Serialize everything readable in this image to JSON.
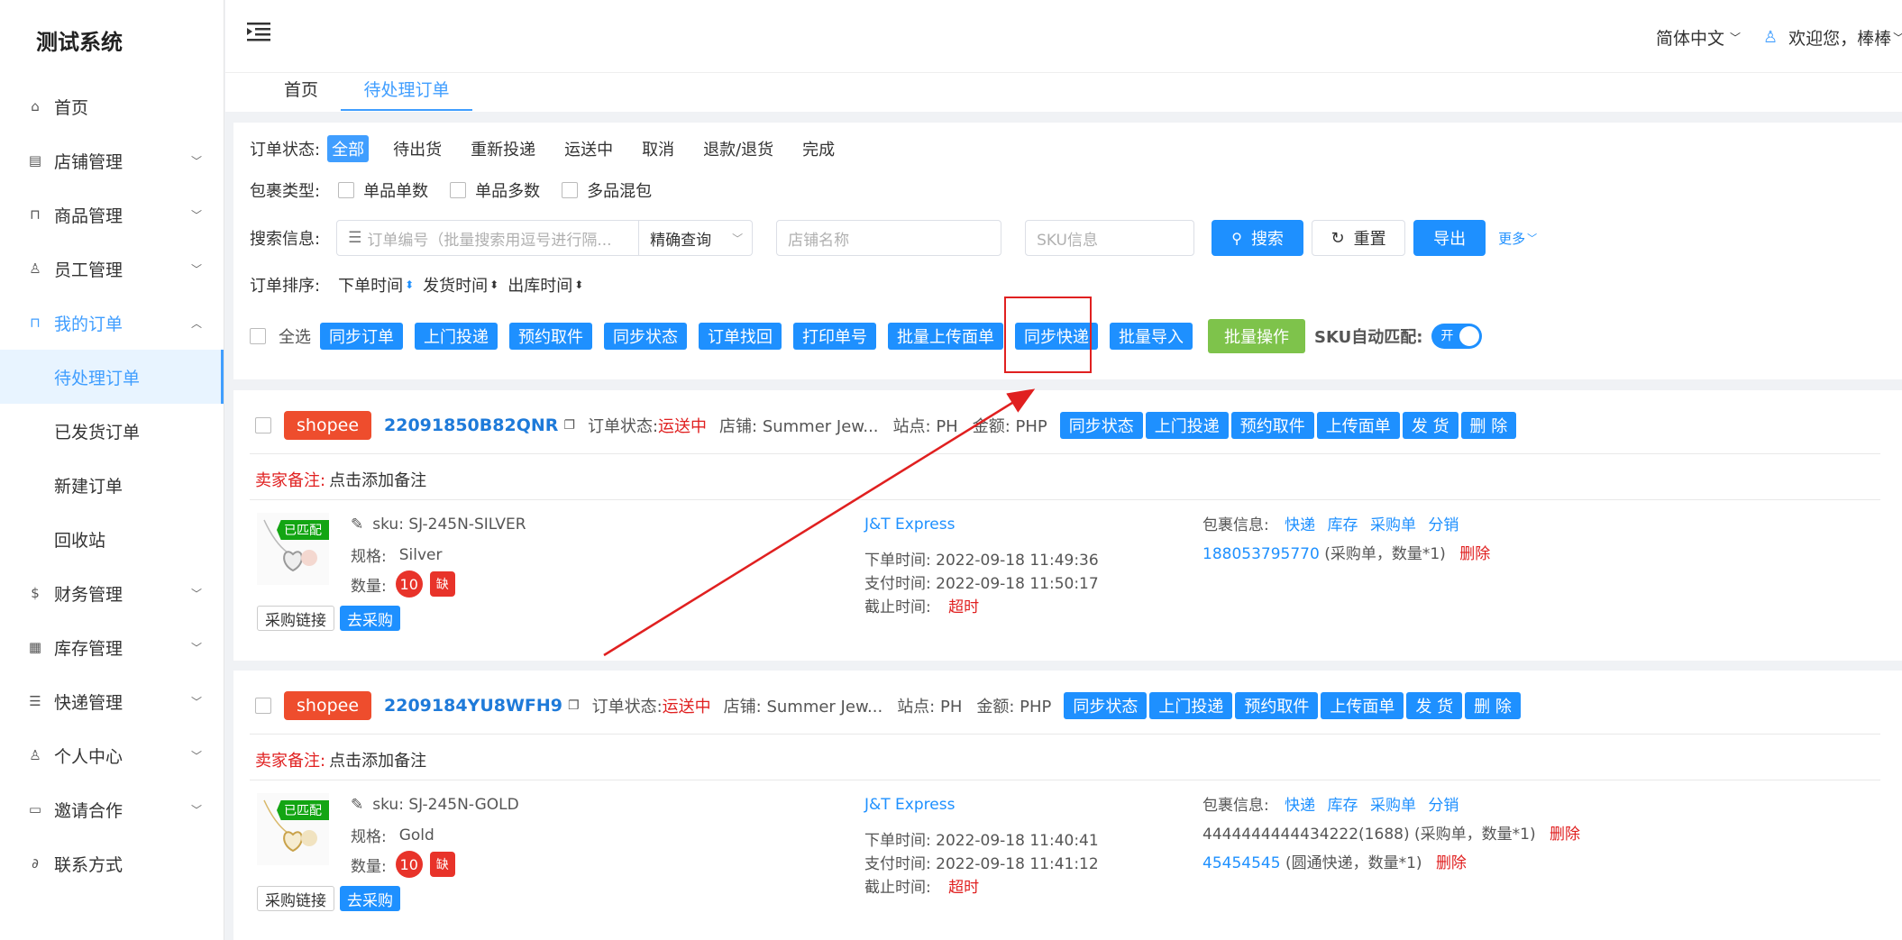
{
  "app": {
    "title": "测试系统"
  },
  "sidebar": {
    "items": [
      {
        "label": "首页"
      },
      {
        "label": "店铺管理"
      },
      {
        "label": "商品管理"
      },
      {
        "label": "员工管理"
      },
      {
        "label": "我的订单"
      },
      {
        "label": "财务管理"
      },
      {
        "label": "库存管理"
      },
      {
        "label": "快递管理"
      },
      {
        "label": "个人中心"
      },
      {
        "label": "邀请合作"
      },
      {
        "label": "联系方式"
      }
    ],
    "order_submenu": [
      {
        "label": "待处理订单"
      },
      {
        "label": "已发货订单"
      },
      {
        "label": "新建订单"
      },
      {
        "label": "回收站"
      }
    ]
  },
  "header": {
    "language": "简体中文",
    "welcome": "欢迎您，棒棒"
  },
  "tabs": [
    {
      "label": "首页"
    },
    {
      "label": "待处理订单"
    }
  ],
  "filters": {
    "status_label": "订单状态:",
    "status_options": [
      "全部",
      "待出货",
      "重新投递",
      "运送中",
      "取消",
      "退款/退货",
      "完成"
    ],
    "package_label": "包裹类型:",
    "package_options": [
      "单品单数",
      "单品多数",
      "多品混包"
    ],
    "search_label": "搜索信息:",
    "order_no_placeholder": "订单编号（批量搜索用逗号进行隔...",
    "match_mode": "精确查询",
    "shop_placeholder": "店铺名称",
    "sku_placeholder": "SKU信息",
    "search_btn": "搜索",
    "reset_btn": "重置",
    "export_btn": "导出",
    "more": "更多",
    "sort_label": "订单排序:",
    "sort_options": [
      "下单时间",
      "发货时间",
      "出库时间"
    ],
    "select_all": "全选",
    "batch_buttons": [
      "同步订单",
      "上门投递",
      "预约取件",
      "同步状态",
      "订单找回",
      "打印单号",
      "批量上传面单",
      "同步快递",
      "批量导入"
    ],
    "batch_ops": "批量操作",
    "sku_auto_match": "SKU自动匹配:",
    "toggle_label": "开"
  },
  "orders": [
    {
      "platform": "shopee",
      "order_no": "22091850B82QNR",
      "status_label": "订单状态:",
      "status": "运送中",
      "shop": "店铺: Summer Jew...",
      "site": "站点: PH",
      "amount": "金额: PHP",
      "actions": [
        "同步状态",
        "上门投递",
        "预约取件",
        "上传面单",
        "发 货",
        "删 除"
      ],
      "remark_label": "卖家备注:",
      "remark": "点击添加备注",
      "matched": "已匹配",
      "sku": "sku: SJ-245N-SILVER",
      "spec_label": "规格:",
      "spec": "Silver",
      "qty_label": "数量:",
      "qty": "10",
      "short": "缺",
      "purchase_link": "采购链接",
      "go_purchase": "去采购",
      "carrier": "J&T Express",
      "order_time": "下单时间:  2022-09-18 11:49:36",
      "pay_time": "支付时间:  2022-09-18 11:50:17",
      "deadline_label": "截止时间:",
      "deadline": "超时",
      "pkg_label": "包裹信息:",
      "pkg_links": [
        "快递",
        "库存",
        "采购单",
        "分销"
      ],
      "pkg_lines": [
        {
          "id": "188053795770",
          "note": "(采购单，数量*1)",
          "del": "删除",
          "link": true
        }
      ]
    },
    {
      "platform": "shopee",
      "order_no": "2209184YU8WFH9",
      "status_label": "订单状态:",
      "status": "运送中",
      "shop": "店铺: Summer Jew...",
      "site": "站点: PH",
      "amount": "金额: PHP",
      "actions": [
        "同步状态",
        "上门投递",
        "预约取件",
        "上传面单",
        "发 货",
        "删 除"
      ],
      "remark_label": "卖家备注:",
      "remark": "点击添加备注",
      "matched": "已匹配",
      "sku": "sku: SJ-245N-GOLD",
      "spec_label": "规格:",
      "spec": "Gold",
      "qty_label": "数量:",
      "qty": "10",
      "short": "缺",
      "purchase_link": "采购链接",
      "go_purchase": "去采购",
      "carrier": "J&T Express",
      "order_time": "下单时间:  2022-09-18 11:40:41",
      "pay_time": "支付时间:  2022-09-18 11:41:12",
      "deadline_label": "截止时间:",
      "deadline": "超时",
      "pkg_label": "包裹信息:",
      "pkg_links": [
        "快递",
        "库存",
        "采购单",
        "分销"
      ],
      "pkg_lines": [
        {
          "id": "4444444444434222(1688)",
          "note": "(采购单，数量*1)",
          "del": "删除",
          "link": false
        },
        {
          "id": "45454545",
          "note": "(圆通快递，数量*1)",
          "del": "删除",
          "link": true
        }
      ]
    }
  ],
  "colors": {
    "primary": "#1e90ff",
    "danger": "#e02020",
    "shopee": "#ee4d2d",
    "success": "#7ec34b",
    "annotation": "#e02020"
  }
}
